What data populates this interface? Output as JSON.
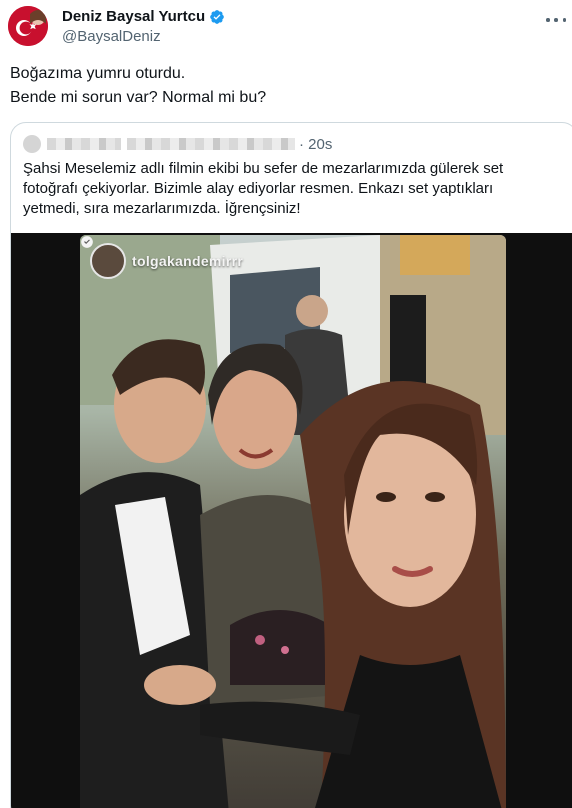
{
  "author": {
    "name": "Deniz Baysal Yurtcu",
    "handle": "@BaysalDeniz"
  },
  "tweet": {
    "lines": [
      "Boğazıma yumru oturdu.",
      "Bende mi sorun var? Normal mi bu?"
    ]
  },
  "quote": {
    "time": "· 20s",
    "lines": [
      "Şahsi Meselemiz adlı filmin ekibi bu sefer de mezarlarımızda gülerek set",
      "fotoğrafı çekiyorlar. Bizimle alay ediyorlar resmen. Enkazı set yaptıkları",
      "yetmedi, sıra mezarlarımızda. İğrençsiniz!"
    ],
    "media": {
      "instagram_username": "tolgakandemirrr"
    }
  },
  "colors": {
    "verified": "#1d9bf0",
    "secondary_text": "#536471",
    "border": "#cfd9de"
  }
}
